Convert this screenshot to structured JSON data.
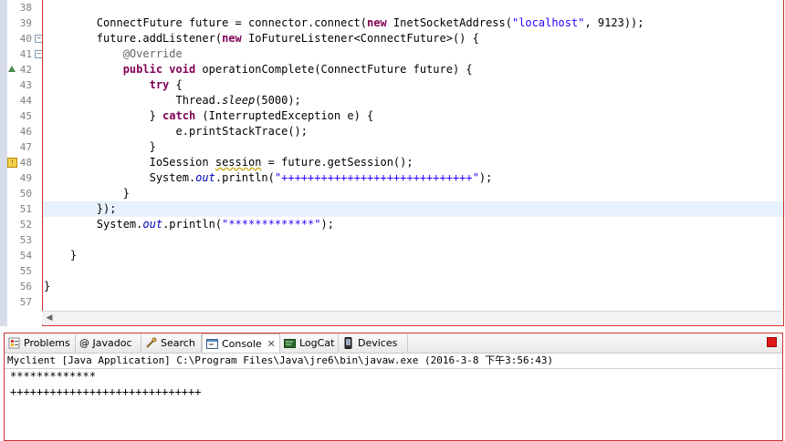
{
  "editor": {
    "line_numbers": [
      "38",
      "39",
      "40",
      "41",
      "42",
      "43",
      "44",
      "45",
      "46",
      "47",
      "48",
      "49",
      "50",
      "51",
      "52",
      "53",
      "54",
      "55",
      "56",
      "57"
    ],
    "lines": [
      {
        "indent": "",
        "parts": []
      },
      {
        "indent": "        ",
        "parts": [
          [
            "t",
            "ConnectFuture future = connector.connect("
          ],
          [
            "kw",
            "new"
          ],
          [
            "t",
            " InetSocketAddress("
          ],
          [
            "str",
            "\"localhost\""
          ],
          [
            "t",
            ", 9123));"
          ]
        ]
      },
      {
        "indent": "        ",
        "parts": [
          [
            "t",
            "future.addListener("
          ],
          [
            "kw",
            "new"
          ],
          [
            "t",
            " IoFutureListener<ConnectFuture>() {"
          ]
        ]
      },
      {
        "indent": "            ",
        "parts": [
          [
            "ann",
            "@Override"
          ]
        ]
      },
      {
        "indent": "            ",
        "parts": [
          [
            "kw",
            "public"
          ],
          [
            "t",
            " "
          ],
          [
            "kw",
            "void"
          ],
          [
            "t",
            " operationComplete(ConnectFuture future) {"
          ]
        ]
      },
      {
        "indent": "                ",
        "parts": [
          [
            "kw",
            "try"
          ],
          [
            "t",
            " {"
          ]
        ]
      },
      {
        "indent": "                    ",
        "parts": [
          [
            "t",
            "Thread."
          ],
          [
            "it",
            "sleep"
          ],
          [
            "t",
            "(5000);"
          ]
        ]
      },
      {
        "indent": "                ",
        "parts": [
          [
            "t",
            "} "
          ],
          [
            "kw",
            "catch"
          ],
          [
            "t",
            " (InterruptedException e) {"
          ]
        ]
      },
      {
        "indent": "                    ",
        "parts": [
          [
            "t",
            "e.printStackTrace();"
          ]
        ]
      },
      {
        "indent": "                ",
        "parts": [
          [
            "t",
            "}"
          ]
        ]
      },
      {
        "indent": "                ",
        "parts": [
          [
            "t",
            "IoSession "
          ],
          [
            "warn",
            "session"
          ],
          [
            "t",
            " = future.getSession();"
          ]
        ]
      },
      {
        "indent": "                ",
        "parts": [
          [
            "t",
            "System."
          ],
          [
            "fld",
            "out"
          ],
          [
            "t",
            ".println("
          ],
          [
            "str",
            "\"+++++++++++++++++++++++++++++\""
          ],
          [
            "t",
            ");"
          ]
        ]
      },
      {
        "indent": "            ",
        "parts": [
          [
            "t",
            "}"
          ]
        ]
      },
      {
        "indent": "        ",
        "parts": [
          [
            "t",
            "});"
          ]
        ]
      },
      {
        "indent": "        ",
        "parts": [
          [
            "t",
            "System."
          ],
          [
            "fld",
            "out"
          ],
          [
            "t",
            ".println("
          ],
          [
            "str",
            "\"*************\""
          ],
          [
            "t",
            ");"
          ]
        ]
      },
      {
        "indent": "",
        "parts": []
      },
      {
        "indent": "    ",
        "parts": [
          [
            "t",
            "}"
          ]
        ]
      },
      {
        "indent": "",
        "parts": []
      },
      {
        "indent": "",
        "parts": [
          [
            "t",
            "}"
          ]
        ]
      },
      {
        "indent": "",
        "parts": []
      }
    ],
    "highlighted_line": "51",
    "fold_markers": [
      "40",
      "41"
    ]
  },
  "tabs": [
    {
      "label": "Problems",
      "icon": "problems-icon"
    },
    {
      "label": "@ Javadoc",
      "icon": "javadoc-icon"
    },
    {
      "label": "Search",
      "icon": "search-icon"
    },
    {
      "label": "Console",
      "icon": "console-icon",
      "active": true,
      "close": "✕"
    },
    {
      "label": "LogCat",
      "icon": "logcat-icon"
    },
    {
      "label": "Devices",
      "icon": "devices-icon"
    }
  ],
  "console": {
    "title": "Myclient [Java Application] C:\\Program Files\\Java\\jre6\\bin\\javaw.exe (2016-3-8 下午3:56:43)",
    "output": [
      "*************",
      "+++++++++++++++++++++++++++++"
    ]
  },
  "colors": {
    "keyword": "#7f0055",
    "string": "#2a00ff",
    "annotation": "#646464",
    "field": "#0000c0",
    "current_line": "#e8f2fe"
  }
}
